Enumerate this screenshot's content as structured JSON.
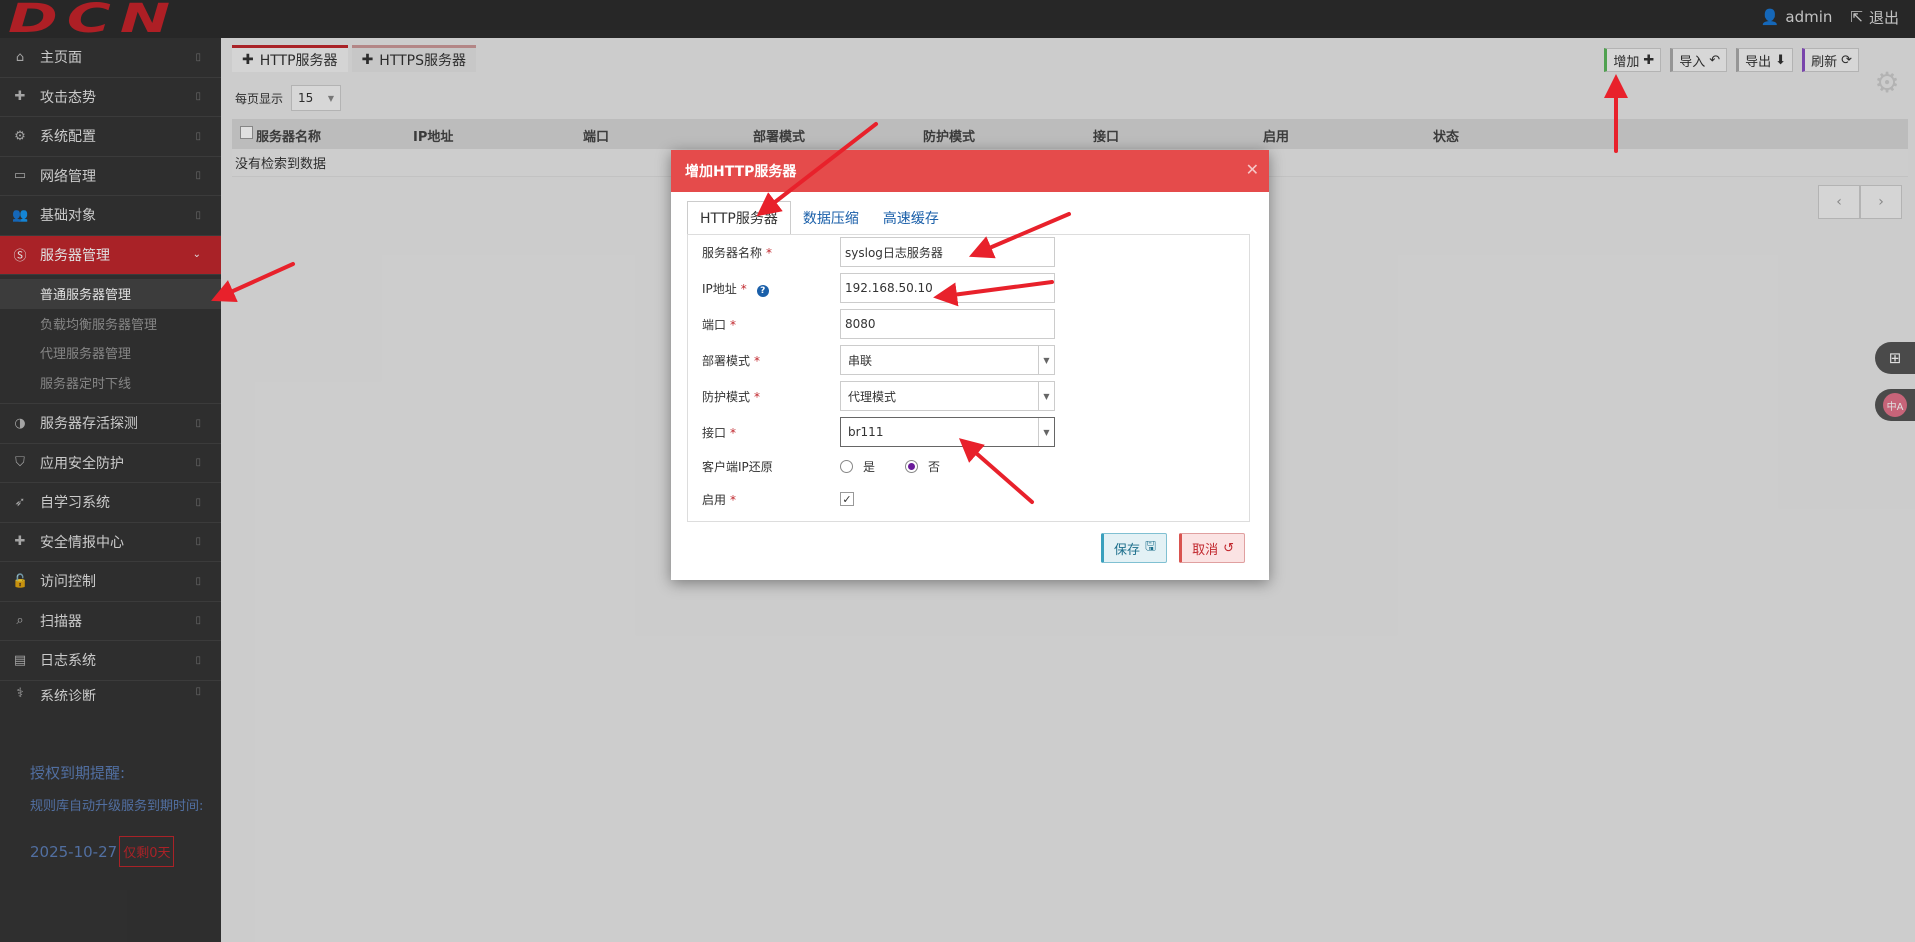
{
  "header": {
    "logo": "DCN",
    "user": "admin",
    "logout": "退出"
  },
  "sidebar": {
    "items": [
      {
        "label": "主页面",
        "icon": "home-icon",
        "glyph": "⌂"
      },
      {
        "label": "攻击态势",
        "icon": "plus-icon",
        "glyph": "✚"
      },
      {
        "label": "系统配置",
        "icon": "cogs-icon",
        "glyph": "⚙"
      },
      {
        "label": "网络管理",
        "icon": "hdd-icon",
        "glyph": "▭"
      },
      {
        "label": "基础对象",
        "icon": "users-icon",
        "glyph": "👥"
      },
      {
        "label": "服务器管理",
        "icon": "skype-icon",
        "glyph": "Ⓢ"
      },
      {
        "label": "服务器存活探测",
        "icon": "adjust-icon",
        "glyph": "◑"
      },
      {
        "label": "应用安全防护",
        "icon": "shield-icon",
        "glyph": "⛉"
      },
      {
        "label": "自学习系统",
        "icon": "rocket-icon",
        "glyph": "➶"
      },
      {
        "label": "安全情报中心",
        "icon": "plus-icon",
        "glyph": "✚"
      },
      {
        "label": "访问控制",
        "icon": "unlock-icon",
        "glyph": "🔓"
      },
      {
        "label": "扫描器",
        "icon": "search-icon",
        "glyph": "⌕"
      },
      {
        "label": "日志系统",
        "icon": "book-icon",
        "glyph": "▤"
      },
      {
        "label": "系统诊断",
        "icon": "stethoscope-icon",
        "glyph": "⚕"
      }
    ],
    "sub_items": [
      "普通服务器管理",
      "负载均衡服务器管理",
      "代理服务器管理",
      "服务器定时下线"
    ],
    "license_title": "授权到期提醒:",
    "license_sub": "规则库自动升级服务到期时间:",
    "license_date": "2025-10-27",
    "license_days": "仅剩0天"
  },
  "main": {
    "tabs": [
      "HTTP服务器",
      "HTTPS服务器"
    ],
    "toolbar": {
      "add": "增加",
      "import": "导入",
      "export": "导出",
      "refresh": "刷新"
    },
    "per_page_label": "每页显示",
    "per_page_value": "15",
    "columns": [
      "服务器名称",
      "IP地址",
      "端口",
      "部署模式",
      "防护模式",
      "接口",
      "启用",
      "状态"
    ],
    "empty_text": "没有检索到数据"
  },
  "modal": {
    "title": "增加HTTP服务器",
    "tabs": [
      "HTTP服务器",
      "数据压缩",
      "高速缓存"
    ],
    "fields": {
      "name_label": "服务器名称",
      "name_value": "syslog日志服务器",
      "ip_label": "IP地址",
      "ip_value": "192.168.50.10",
      "port_label": "端口",
      "port_value": "8080",
      "deploy_label": "部署模式",
      "deploy_value": "串联",
      "protect_label": "防护模式",
      "protect_value": "代理模式",
      "iface_label": "接口",
      "iface_value": "br111",
      "client_ip_label": "客户端IP还原",
      "client_ip_yes": "是",
      "client_ip_no": "否",
      "enable_label": "启用"
    },
    "save": "保存",
    "cancel": "取消"
  },
  "float": {
    "lang": "中A"
  },
  "colors": {
    "accent": "#c1272d",
    "modal_header": "#e54b4b",
    "link": "#1a5fa9"
  }
}
